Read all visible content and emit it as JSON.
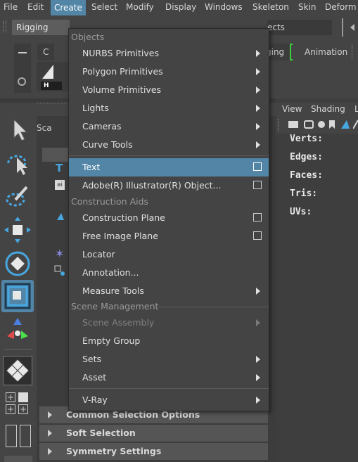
{
  "menubar": {
    "items": [
      "File",
      "Edit",
      "Create",
      "Select",
      "Modify",
      "Display",
      "Windows",
      "Skeleton",
      "Skin",
      "Deform"
    ],
    "active": "Create"
  },
  "toolbar": {
    "menuset": "Rigging",
    "object_field": "ects"
  },
  "shelf": {
    "tabs": [
      "C",
      "ging",
      "Animation"
    ],
    "button_label": "H"
  },
  "sidebar": {
    "scale_label": "Sca"
  },
  "viewport": {
    "menus": [
      "View",
      "Shading",
      "L"
    ],
    "hud": [
      "Verts:",
      "Edges:",
      "Faces:",
      "Tris:",
      "UVs:"
    ]
  },
  "menu": {
    "sections": {
      "objects": "Objects",
      "construction_aids": "Construction Aids",
      "scene_management": "Scene Management"
    },
    "items": [
      {
        "label": "NURBS Primitives",
        "submenu": true
      },
      {
        "label": "Polygon Primitives",
        "submenu": true
      },
      {
        "label": "Volume Primitives",
        "submenu": true
      },
      {
        "label": "Lights",
        "submenu": true
      },
      {
        "label": "Cameras",
        "submenu": true
      },
      {
        "label": "Curve Tools",
        "submenu": true
      },
      {
        "label": "Text",
        "options": true,
        "highlighted": true
      },
      {
        "label": "Adobe(R) Illustrator(R) Object...",
        "options": true
      },
      {
        "label": "Construction Plane",
        "options": true
      },
      {
        "label": "Free Image Plane",
        "options": true
      },
      {
        "label": "Locator"
      },
      {
        "label": "Annotation..."
      },
      {
        "label": "Measure Tools",
        "submenu": true
      },
      {
        "label": "Scene Assembly",
        "submenu": true,
        "disabled": true
      },
      {
        "label": "Empty Group"
      },
      {
        "label": "Sets",
        "submenu": true
      },
      {
        "label": "Asset",
        "submenu": true
      },
      {
        "label": "V-Ray",
        "submenu": true
      }
    ]
  },
  "frames": [
    "Common Selection Options",
    "Soft Selection",
    "Symmetry Settings"
  ],
  "colors": {
    "highlight": "#5285a6",
    "background": "#444444",
    "accent_green": "#3ccf3c"
  }
}
